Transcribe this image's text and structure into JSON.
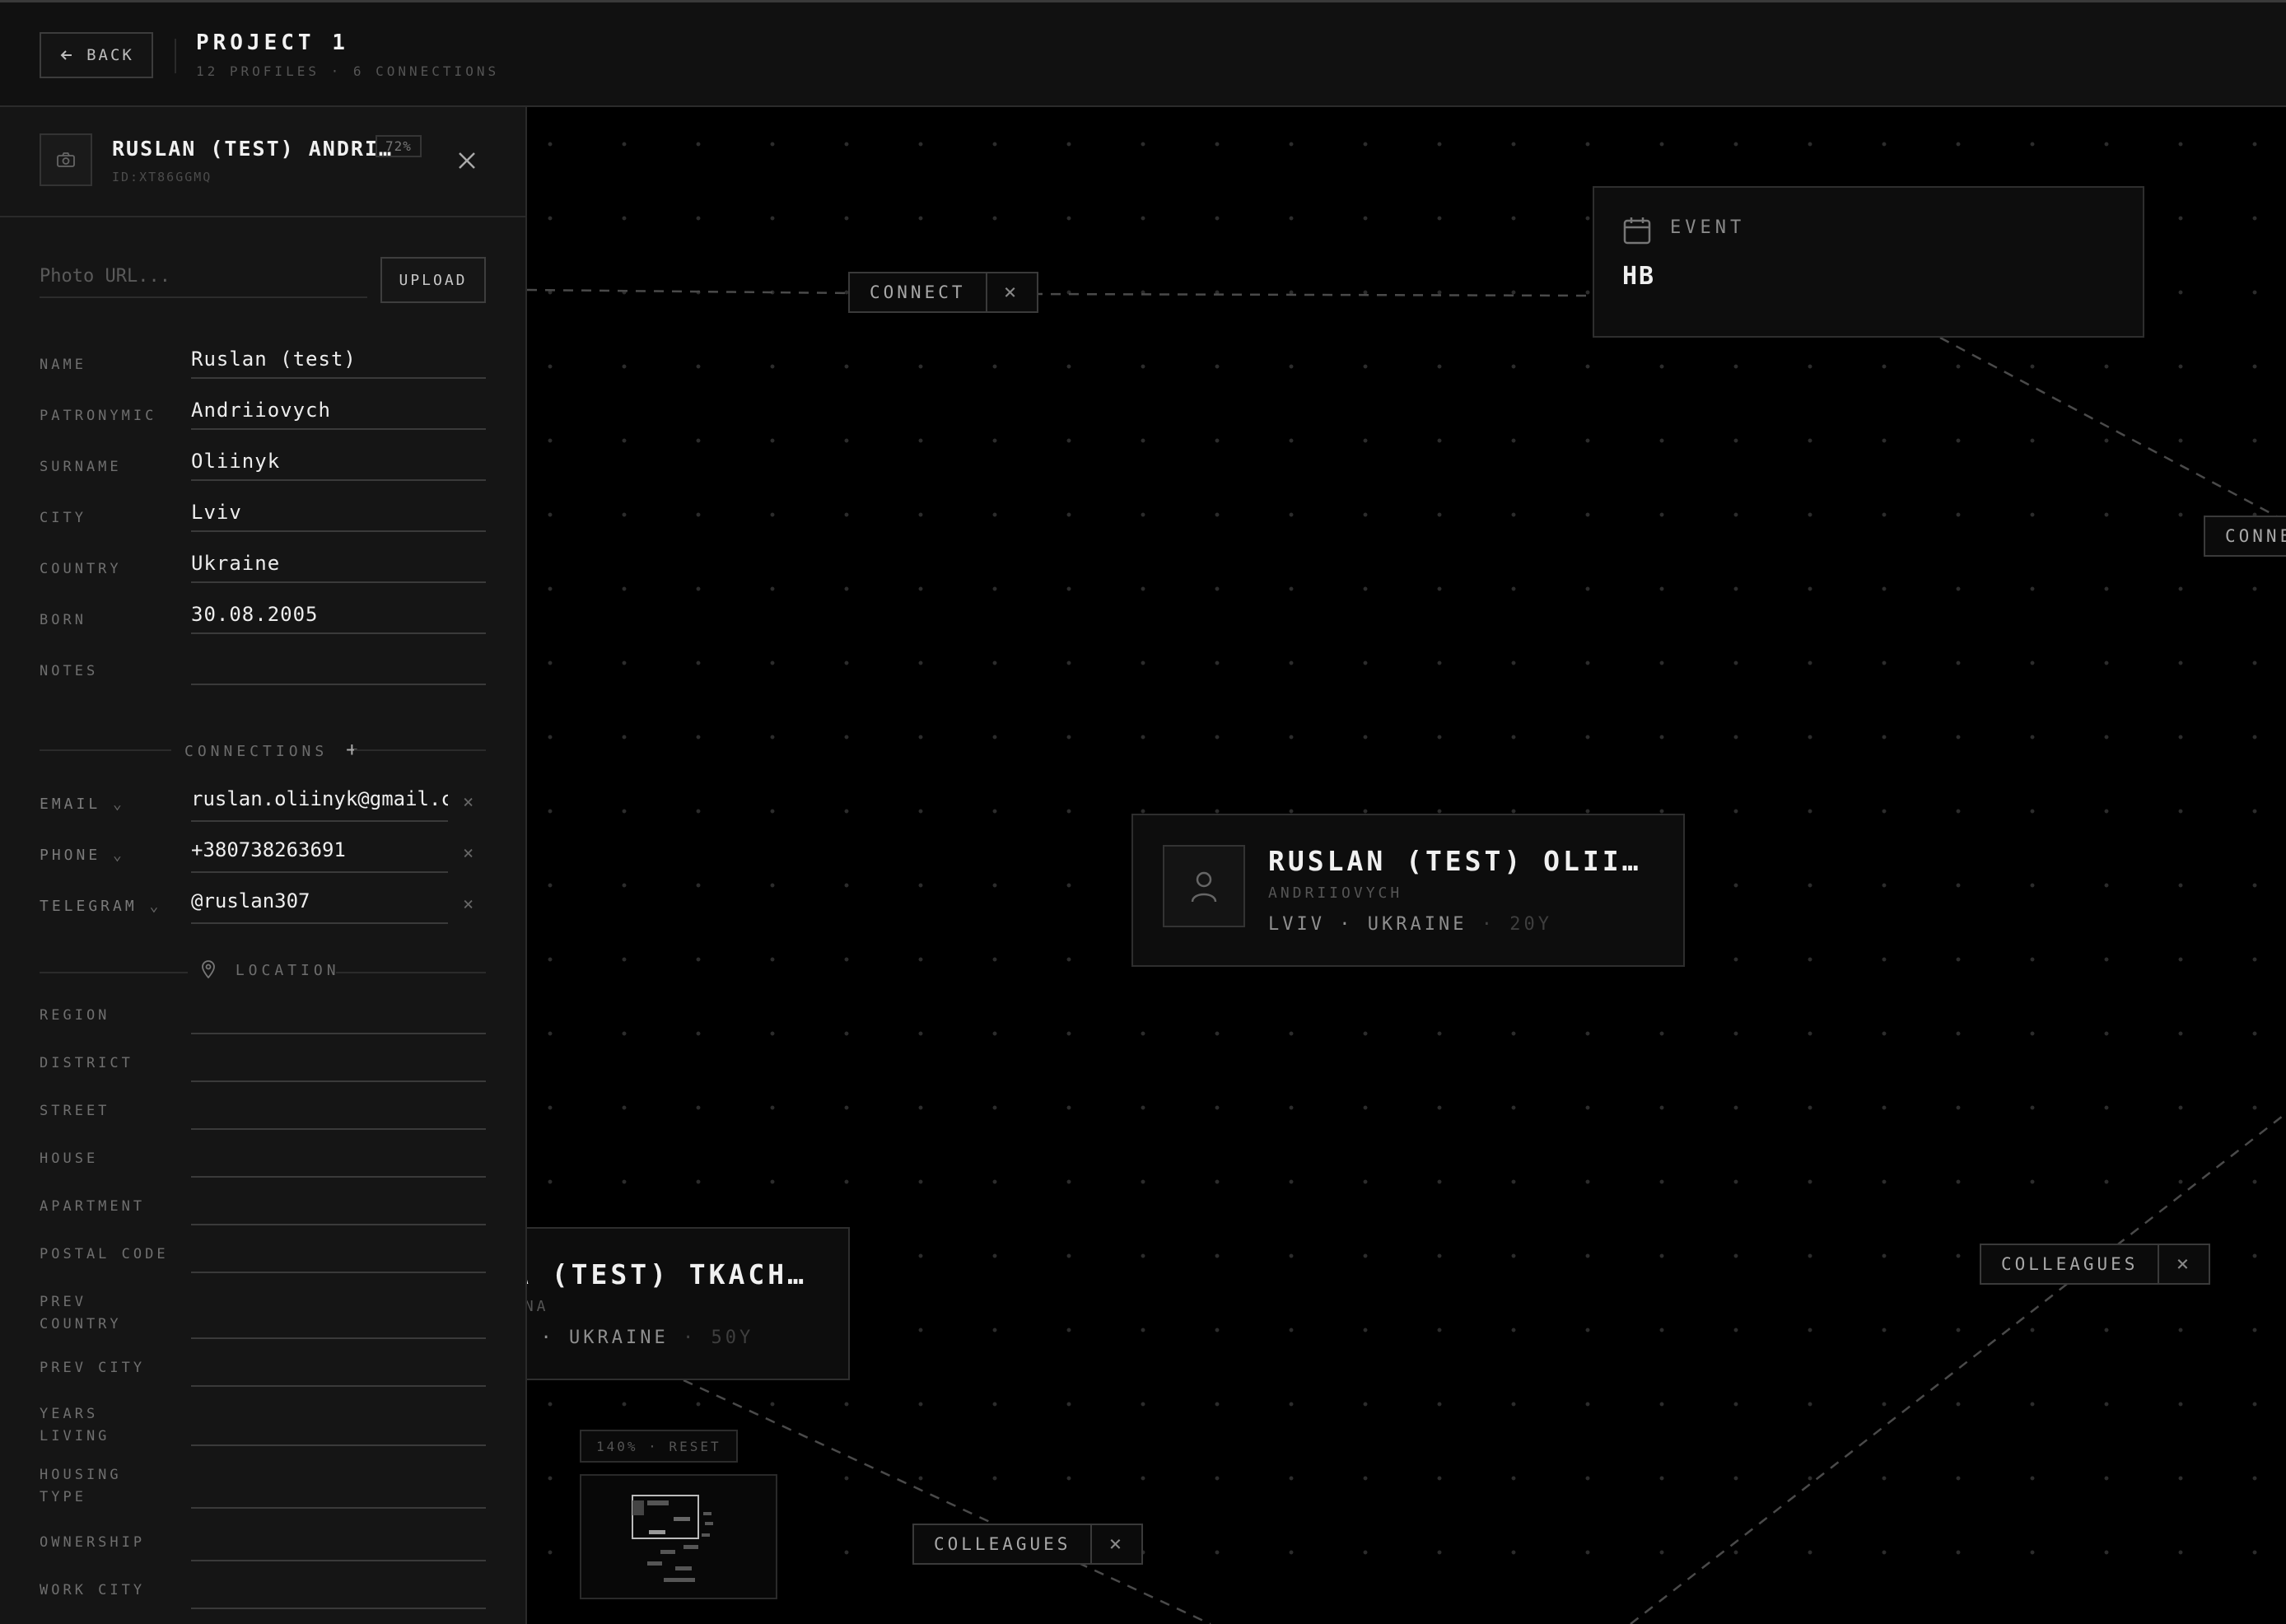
{
  "header": {
    "back_label": "BACK",
    "project_title": "PROJECT 1",
    "project_subtitle": "12 PROFILES · 6 CONNECTIONS"
  },
  "panel": {
    "profile_name": "RUSLAN (TEST) ANDRI…",
    "completeness": "72%",
    "profile_id": "ID:XT86GGMQ",
    "photo_url_placeholder": "Photo URL...",
    "upload_label": "UPLOAD",
    "fields": [
      {
        "label": "NAME",
        "value": "Ruslan (test)"
      },
      {
        "label": "PATRONYMIC",
        "value": "Andriiovych"
      },
      {
        "label": "SURNAME",
        "value": "Oliinyk"
      },
      {
        "label": "CITY",
        "value": "Lviv"
      },
      {
        "label": "COUNTRY",
        "value": "Ukraine"
      },
      {
        "label": "BORN",
        "value": "30.08.2005"
      },
      {
        "label": "NOTES",
        "value": ""
      }
    ],
    "connections_title": "CONNECTIONS",
    "connections_add": "+",
    "connections": [
      {
        "type": "EMAIL",
        "value": "ruslan.oliinyk@gmail.com"
      },
      {
        "type": "PHONE",
        "value": "+380738263691"
      },
      {
        "type": "TELEGRAM",
        "value": "@ruslan307"
      }
    ],
    "location_title": "LOCATION",
    "location_fields": [
      {
        "label": "REGION"
      },
      {
        "label": "DISTRICT"
      },
      {
        "label": "STREET"
      },
      {
        "label": "HOUSE"
      },
      {
        "label": "APARTMENT"
      },
      {
        "label": "POSTAL CODE"
      },
      {
        "label": "PREV COUNTRY"
      },
      {
        "label": "PREV CITY"
      },
      {
        "label": "YEARS LIVING"
      },
      {
        "label": "HOUSING TYPE"
      },
      {
        "label": "OWNERSHIP"
      },
      {
        "label": "WORK CITY"
      }
    ]
  },
  "canvas": {
    "event_node": {
      "type": "EVENT",
      "title": "HB",
      "icon": "calendar-icon"
    },
    "person_node": {
      "name": "RUSLAN (TEST) OLII…",
      "patronymic": "ANDRIIOVYCH",
      "city": "LVIV",
      "country": "UKRAINE",
      "age": "20Y",
      "icon": "user-icon"
    },
    "person_node_2": {
      "name": "A (TEST) TKACH…",
      "patronymic": "VNA",
      "city": "O",
      "country": "UKRAINE",
      "age": "50Y"
    },
    "edge_labels": {
      "connect_1": "CONNECT",
      "connect_2": "CONNE",
      "colleagues_1": "COLLEAGUES",
      "colleagues_2": "COLLEAGUES"
    },
    "zoom_badge": "140% · RESET"
  }
}
